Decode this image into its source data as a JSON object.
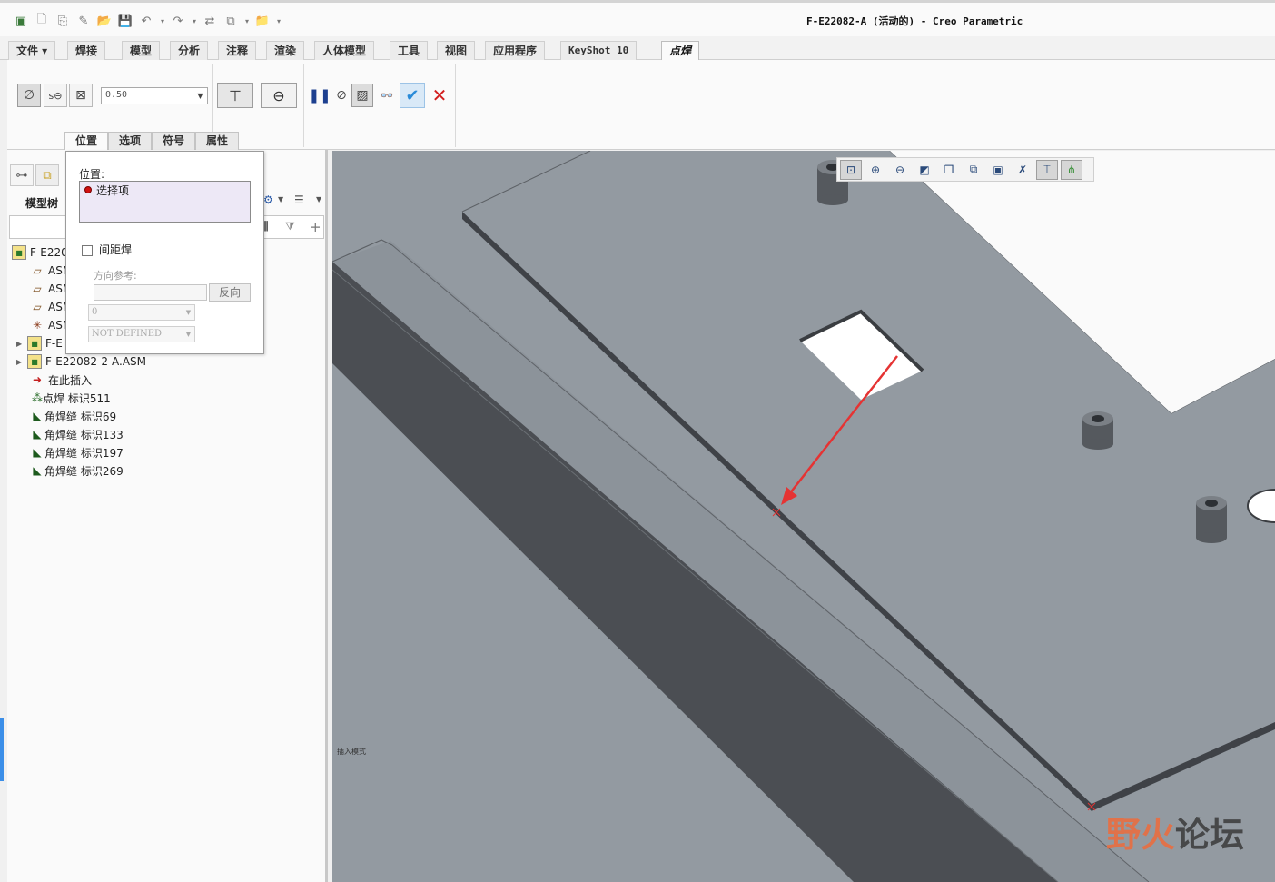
{
  "window": {
    "title": "F-E22082-A (活动的) - Creo Parametric"
  },
  "ribbon_tabs": [
    {
      "label": "文件 ▾"
    },
    {
      "label": "焊接"
    },
    {
      "label": "模型"
    },
    {
      "label": "分析"
    },
    {
      "label": "注释"
    },
    {
      "label": "渲染"
    },
    {
      "label": "人体模型"
    },
    {
      "label": "工具"
    },
    {
      "label": "视图"
    },
    {
      "label": "应用程序"
    },
    {
      "label": "KeyShot 10"
    },
    {
      "label": "点焊",
      "active": true
    }
  ],
  "dashboard": {
    "dimension_value": "0.50",
    "subtabs": [
      "位置",
      "选项",
      "符号",
      "属性"
    ],
    "colors": {
      "accept": "#2a8bd8",
      "cancel": "#d21e1e",
      "pause": "#1d3f8f"
    }
  },
  "placement_panel": {
    "placement_label": "位置:",
    "collector_item": "选择项",
    "interval_weld_label": "间距焊",
    "direction_ref_label": "方向参考:",
    "flip_button": "反向",
    "offset_value": "0",
    "undefined_value": "NOT DEFINED"
  },
  "model_tree": {
    "title": "模型树",
    "items": [
      {
        "label": "F-E220",
        "icon": "assembly-icon",
        "indent": 0,
        "expander": ""
      },
      {
        "label": "ASM",
        "icon": "datum-plane-icon",
        "indent": 1,
        "expander": ""
      },
      {
        "label": "ASM",
        "icon": "datum-plane-icon",
        "indent": 1,
        "expander": ""
      },
      {
        "label": "ASM",
        "icon": "datum-plane-icon",
        "indent": 1,
        "expander": ""
      },
      {
        "label": "ASM",
        "icon": "csys-icon",
        "indent": 1,
        "expander": ""
      },
      {
        "label": "F-E",
        "icon": "assembly-icon",
        "indent": 1,
        "expander": "▶"
      },
      {
        "label": "F-E22082-2-A.ASM",
        "icon": "assembly-icon",
        "indent": 1,
        "expander": "▶"
      },
      {
        "label": "在此插入",
        "icon": "insert-here-icon",
        "indent": 1,
        "expander": ""
      },
      {
        "label": "点焊 标识511",
        "icon": "spot-weld-icon",
        "indent": 1,
        "expander": ""
      },
      {
        "label": "角焊缝 标识69",
        "icon": "fillet-weld-icon",
        "indent": 1,
        "expander": ""
      },
      {
        "label": "角焊缝 标识133",
        "icon": "fillet-weld-icon",
        "indent": 1,
        "expander": ""
      },
      {
        "label": "角焊缝 标识197",
        "icon": "fillet-weld-icon",
        "indent": 1,
        "expander": ""
      },
      {
        "label": "角焊缝 标识269",
        "icon": "fillet-weld-icon",
        "indent": 1,
        "expander": ""
      }
    ]
  },
  "viewport": {
    "status_text": "插入模式",
    "watermark_left": "野火",
    "watermark_right": "论坛",
    "colors": {
      "surface": "#939aa1",
      "side": "#4b4e53",
      "arrow": "#e53333"
    }
  }
}
